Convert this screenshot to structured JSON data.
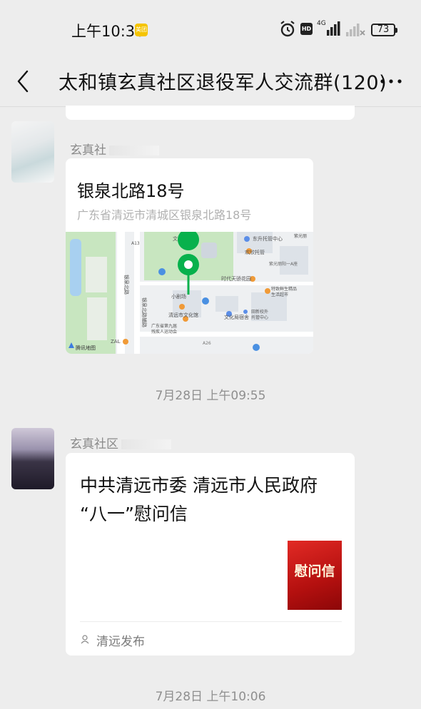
{
  "status_bar": {
    "time": "上午10:36",
    "app_badge": "美团",
    "hd": "HD",
    "network": "4G",
    "battery": "73"
  },
  "header": {
    "title": "太和镇玄真社区退役军人交流群(120)",
    "back_icon": "chevron-left-icon",
    "more_icon": "ellipsis-icon"
  },
  "messages": [
    {
      "type": "location",
      "sender": "玄真社",
      "title": "银泉北路18号",
      "address": "广东省清远市清城区银泉北路18号",
      "map": {
        "pois": [
          "文化广场",
          "东升托管中心",
          "欢欣托管",
          "紫光丽阳一A座",
          "时代天骄花园",
          "小剧场",
          "清远市文化馆",
          "特致鲜生精品生活超市",
          "文化局宿舍",
          "田新校外托管中心",
          "广东省第九届残疾人运动会",
          "紫光丽",
          "A26",
          "ZAL"
        ],
        "road_labels": [
          "银泉北路",
          "银泉北路辅路",
          "A13"
        ],
        "provider": "腾讯地图"
      }
    },
    {
      "type": "timestamp",
      "text": "7月28日 上午09:55"
    },
    {
      "type": "article",
      "sender": "玄真社区",
      "title_line1": "中共清远市委 清远市人民政府",
      "title_line2": "“八一”慰问信",
      "thumb_text": "慰问信",
      "source": "清远发布"
    },
    {
      "type": "timestamp",
      "text": "7月28日 上午10:06"
    }
  ],
  "colors": {
    "background": "#ededed",
    "card": "#ffffff",
    "map_marker": "#07b14c",
    "thumb_red": "#c8161d"
  }
}
